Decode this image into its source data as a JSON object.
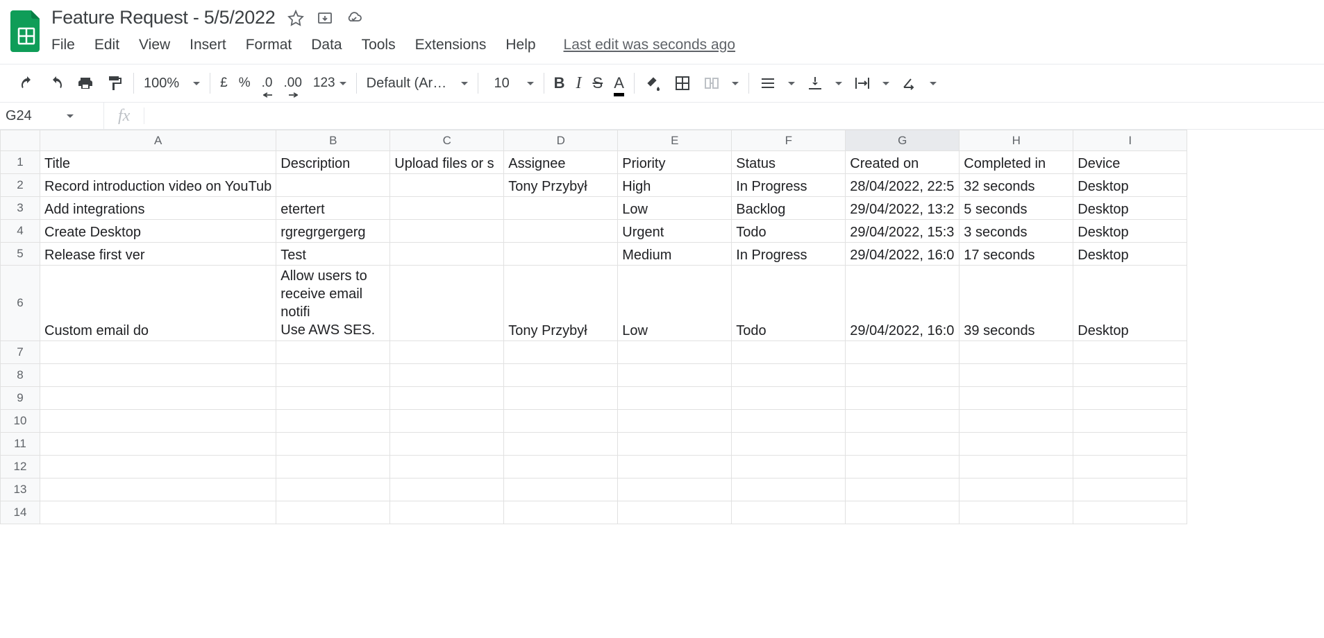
{
  "header": {
    "title": "Feature Request - 5/5/2022",
    "menus": [
      "File",
      "Edit",
      "View",
      "Insert",
      "Format",
      "Data",
      "Tools",
      "Extensions",
      "Help"
    ],
    "last_edit": "Last edit was seconds ago"
  },
  "toolbar": {
    "zoom": "100%",
    "currency": "£",
    "percent": "%",
    "dec_dec": ".0",
    "inc_dec": ".00",
    "more_formats": "123",
    "font_name": "Default (Ari…",
    "font_size": "10",
    "bold": "B",
    "italic": "I",
    "strike": "S",
    "text_color": "A"
  },
  "name_box": "G24",
  "fx_label": "fx",
  "columns": [
    "A",
    "B",
    "C",
    "D",
    "E",
    "F",
    "G",
    "H",
    "I"
  ],
  "selected_column": "G",
  "chart_data": {
    "type": "table",
    "headers": [
      "Title",
      "Description",
      "Upload files or screenshots",
      "Assignee",
      "Priority",
      "Status",
      "Created on",
      "Completed in",
      "Device"
    ],
    "rows": [
      {
        "Title": "Record introduction video on YouTub",
        "Description": "",
        "Upload": "",
        "Assignee": "Tony Przybył",
        "Priority": "High",
        "Status": "In Progress",
        "Created on": "28/04/2022, 22:5",
        "Completed in": "32 seconds",
        "Device": "Desktop"
      },
      {
        "Title": "Add integrations",
        "Description": "etertert",
        "Upload": "",
        "Assignee": "",
        "Priority": "Low",
        "Status": "Backlog",
        "Created on": "29/04/2022, 13:2",
        "Completed in": "5 seconds",
        "Device": "Desktop"
      },
      {
        "Title": "Create Desktop",
        "Description": "rgregrgergerg",
        "Upload": "",
        "Assignee": "",
        "Priority": "Urgent",
        "Status": "Todo",
        "Created on": "29/04/2022, 15:3",
        "Completed in": "3 seconds",
        "Device": "Desktop"
      },
      {
        "Title": "Release first ver",
        "Description": "Test",
        "Upload": "",
        "Assignee": "",
        "Priority": "Medium",
        "Status": "In Progress",
        "Created on": "29/04/2022, 16:0",
        "Completed in": "17 seconds",
        "Device": "Desktop"
      },
      {
        "Title": "Custom email do",
        "Description": "Allow users to receive email notifi\nUse AWS SES.",
        "Upload": "",
        "Assignee": "Tony Przybył",
        "Priority": "Low",
        "Status": "Todo",
        "Created on": "29/04/2022, 16:0",
        "Completed in": "39 seconds",
        "Device": "Desktop"
      }
    ]
  },
  "hdr": {
    "title": "Title",
    "desc": "Description",
    "upload": "Upload files or s",
    "assignee": "Assignee",
    "priority": "Priority",
    "status": "Status",
    "created": "Created on",
    "completed": "Completed in",
    "device": "Device"
  },
  "r1": {
    "a": "Record introduction video on YouTub",
    "b": "",
    "c": "",
    "d": "Tony Przybył",
    "e": "High",
    "f": "In Progress",
    "g": "28/04/2022, 22:5",
    "h": "32 seconds",
    "i": "Desktop"
  },
  "r2": {
    "a": "Add integrations",
    "b": "etertert",
    "c": "",
    "d": "",
    "e": "Low",
    "f": "Backlog",
    "g": "29/04/2022, 13:2",
    "h": "5 seconds",
    "i": "Desktop"
  },
  "r3": {
    "a": "Create Desktop",
    "b": "rgregrgergerg",
    "c": "",
    "d": "",
    "e": "Urgent",
    "f": "Todo",
    "g": "29/04/2022, 15:3",
    "h": "3 seconds",
    "i": "Desktop"
  },
  "r4": {
    "a": "Release first ver",
    "b": "Test",
    "c": "",
    "d": "",
    "e": "Medium",
    "f": "In Progress",
    "g": "29/04/2022, 16:0",
    "h": "17 seconds",
    "i": "Desktop"
  },
  "r5": {
    "a": "Custom email do",
    "b": "Allow users to receive email notifi\nUse AWS SES.",
    "c": "",
    "d": "Tony Przybył",
    "e": "Low",
    "f": "Todo",
    "g": "29/04/2022, 16:0",
    "h": "39 seconds",
    "i": "Desktop"
  },
  "row_numbers": [
    "1",
    "2",
    "3",
    "4",
    "5",
    "6",
    "7",
    "8",
    "9",
    "10",
    "11",
    "12",
    "13",
    "14"
  ]
}
